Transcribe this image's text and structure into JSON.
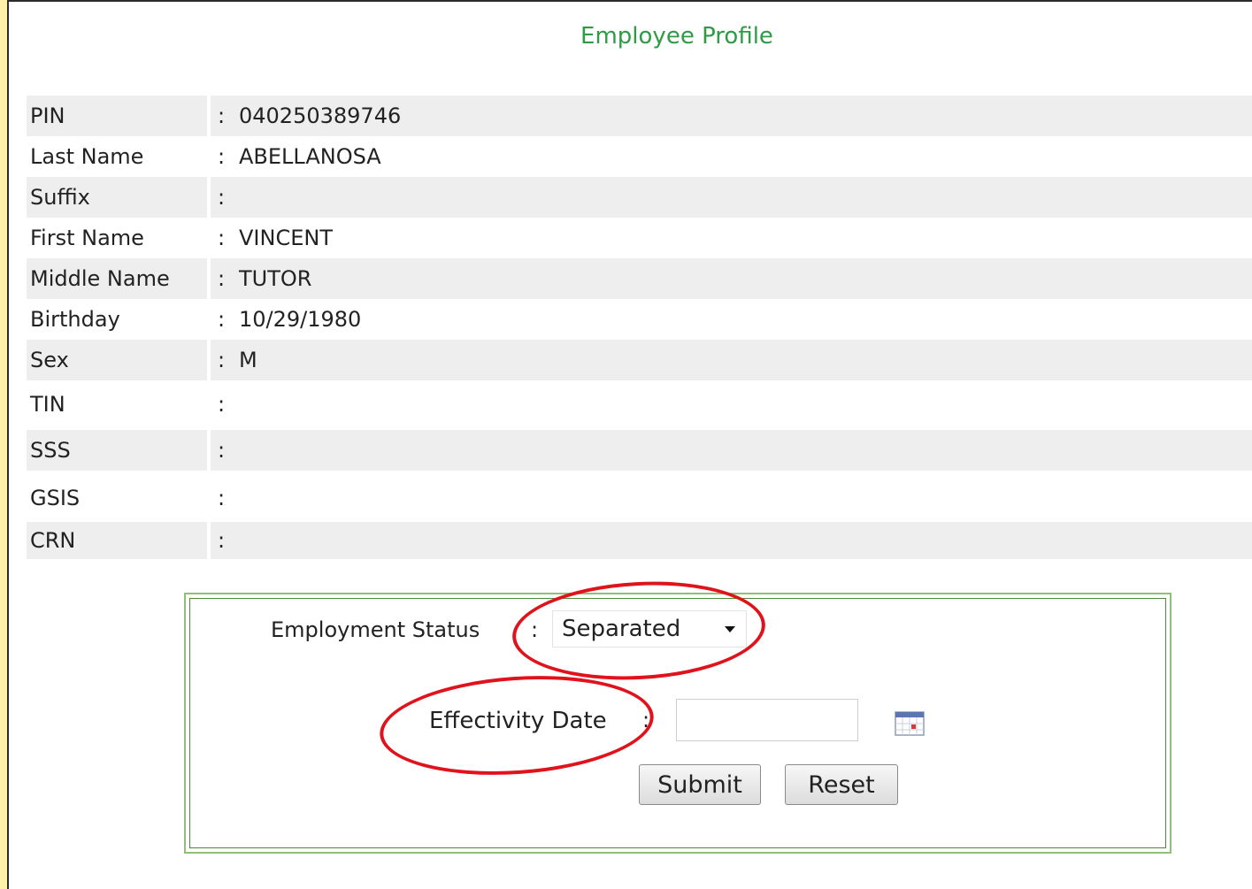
{
  "page": {
    "title": "Employee Profile"
  },
  "profile": {
    "separator": ":",
    "rows": [
      {
        "label": "PIN",
        "value": "040250389746"
      },
      {
        "label": "Last Name",
        "value": "ABELLANOSA"
      },
      {
        "label": "Suffix",
        "value": ""
      },
      {
        "label": "First Name",
        "value": "VINCENT"
      },
      {
        "label": "Middle Name",
        "value": "TUTOR"
      },
      {
        "label": "Birthday",
        "value": "10/29/1980"
      },
      {
        "label": "Sex",
        "value": "M"
      },
      {
        "label": "TIN",
        "value": ""
      },
      {
        "label": "SSS",
        "value": ""
      },
      {
        "label": "GSIS",
        "value": ""
      },
      {
        "label": "CRN",
        "value": ""
      }
    ]
  },
  "form": {
    "employment_status_label": "Employment Status",
    "employment_status_value": "Separated",
    "effectivity_date_label": "Effectivity Date",
    "effectivity_date_value": "",
    "separator": ":",
    "submit_label": "Submit",
    "reset_label": "Reset",
    "calendar_icon": "calendar-icon"
  },
  "colors": {
    "title": "#2e9b45",
    "row_shade": "#eeeeee",
    "panel_border": "#4e8a3a",
    "annotation": "#e0121b"
  }
}
